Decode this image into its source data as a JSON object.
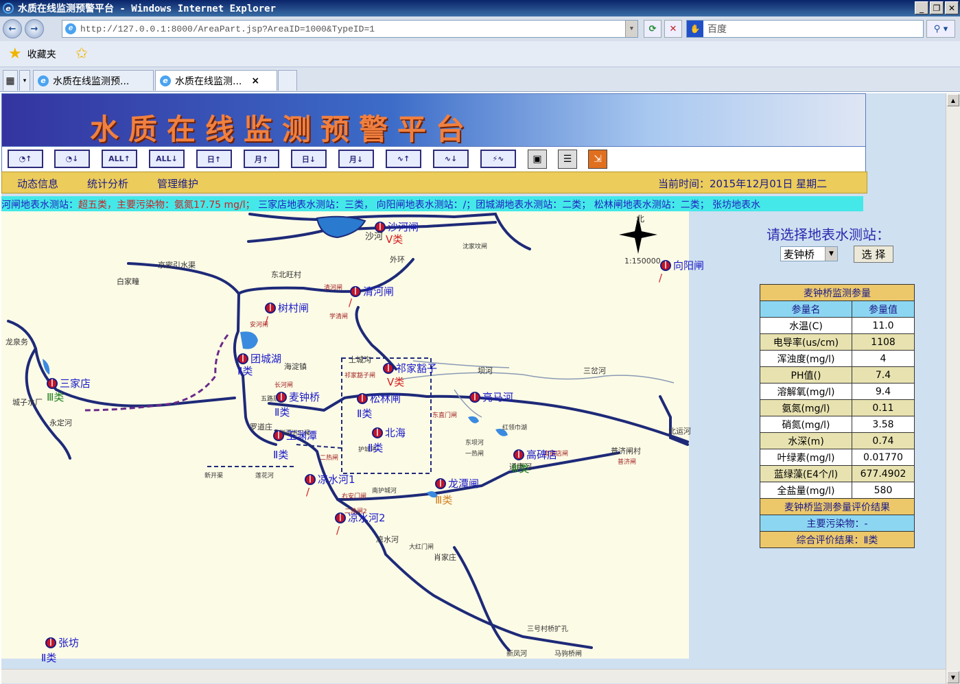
{
  "window": {
    "title": "水质在线监测预警平台 - Windows Internet Explorer"
  },
  "browser": {
    "url": "http://127.0.0.1:8000/AreaPart.jsp?AreaID=1000&TypeID=1",
    "search_placeholder": "百度",
    "favorites_label": "收藏夹",
    "tabs": [
      {
        "label": "水质在线监测预..."
      },
      {
        "label": "水质在线监测...",
        "close": "×"
      }
    ]
  },
  "page": {
    "banner_title": "水质在线监测预警平台",
    "toolbar_buttons": [
      "rt-up",
      "rt-down",
      "all-up",
      "all-down",
      "day-up",
      "month-up",
      "day-down",
      "month-down",
      "trend-up",
      "trend-down",
      "alarm",
      "monitor",
      "report",
      "export"
    ],
    "menu": [
      "动态信息",
      "统计分析",
      "管理维护"
    ],
    "current_time": "当前时间：2015年12月01日 星期二",
    "ticker": {
      "part1": "河闸地表水测站：",
      "part2": "超五类，主要污染物：氨氮17.75 mg/l；",
      "part3": "  三家店地表水测站：三类，  向阳闸地表水测站：/；团城湖地表水测站：二类；  松林闸地表水测站：二类；  张坊地表水"
    }
  },
  "map": {
    "stations": [
      {
        "name": "沙河闸",
        "class": "Ⅴ类",
        "class_color": "#d02020"
      },
      {
        "name": "向阳闸",
        "class": "/",
        "class_color": "#d02020"
      },
      {
        "name": "清河闸",
        "class": "/",
        "class_color": "#d02020"
      },
      {
        "name": "树村闸",
        "class": "/",
        "class_color": "#d02020"
      },
      {
        "name": "团城湖",
        "class": "Ⅱ类",
        "class_color": "#1a1ac8"
      },
      {
        "name": "祁家豁子",
        "class": "Ⅴ类",
        "class_color": "#d02020"
      },
      {
        "name": "三家店",
        "class": "Ⅲ类",
        "class_color": "#208020"
      },
      {
        "name": "麦钟桥",
        "class": "Ⅱ类",
        "class_color": "#1a1ac8"
      },
      {
        "name": "松林闸",
        "class": "Ⅱ类",
        "class_color": "#1a1ac8"
      },
      {
        "name": "亮马河",
        "class": "",
        "class_color": "#1a1ac8"
      },
      {
        "name": "北海",
        "class": "Ⅱ类",
        "class_color": "#1a1ac8"
      },
      {
        "name": "玉渊潭",
        "class": "Ⅱ类",
        "class_color": "#1a1ac8"
      },
      {
        "name": "高碑店",
        "class": "Ⅲ类",
        "class_color": "#208020"
      },
      {
        "name": "凉水河1",
        "class": "/",
        "class_color": "#d02020"
      },
      {
        "name": "龙潭闸",
        "class": "Ⅲ类",
        "class_color": "#d08020"
      },
      {
        "name": "凉水河2",
        "class": "/",
        "class_color": "#d02020"
      },
      {
        "name": "张坊",
        "class": "Ⅱ类",
        "class_color": "#1a1ac8"
      }
    ],
    "labels": {
      "north": "北",
      "scale": "1:150000",
      "place_1": "沙河",
      "place_2": "东北旺村",
      "place_3": "白家疃",
      "place_4": "海淀镇",
      "place_5": "三岔河",
      "place_6": "肖家庄",
      "place_7": "罗道庄",
      "place_8": "普济闸村",
      "place_9": "龙泉务",
      "place_10": "城子水厂",
      "place_11": "三号村桥扩孔",
      "place_12": "马驹桥闸",
      "place_13": "沈家坟闸",
      "place_14": "大红门闸",
      "place_15": "北运河",
      "river_1": "京密引水渠",
      "river_2": "永定河",
      "river_3": "凉水河",
      "river_4": "通惠河",
      "river_5": "外环",
      "river_6": "土城沟",
      "river_7": "坝河",
      "river_8": "新凤河",
      "pump_1": "安河闸",
      "pump_2": "清河闸",
      "pump_3": "学清闸",
      "pump_4": "祁家豁子闸",
      "pump_5": "东直门闸",
      "pump_6": "二热闸",
      "pump_7": "高碑店闸",
      "pump_8": "普济闸",
      "pump_9": "长河闸",
      "pump_10": "右安门闸",
      "pump_11": "红领巾湖",
      "pump_12": "东坝河",
      "pump_13": "一热闸",
      "pump_14": "南护城河",
      "pump_15": "护城河",
      "pump_16": "二热闸2",
      "pump_17": "新开渠",
      "pump_18": "莲花河",
      "pump_19": "玉渊潭进口闸",
      "pump_20": "五路居"
    }
  },
  "panel": {
    "prompt": "请选择地表水测站：",
    "selected_station": "麦钟桥",
    "select_button": "选 择",
    "table_title": "麦钟桥监测参量",
    "col_name": "参量名",
    "col_value": "参量值",
    "params": [
      {
        "name": "水温(C)",
        "value": "11.0"
      },
      {
        "name": "电导率(us/cm)",
        "value": "1108"
      },
      {
        "name": "浑浊度(mg/l)",
        "value": "4"
      },
      {
        "name": "PH值()",
        "value": "7.4"
      },
      {
        "name": "溶解氧(mg/l)",
        "value": "9.4"
      },
      {
        "name": "氨氮(mg/l)",
        "value": "0.11"
      },
      {
        "name": "硝氮(mg/l)",
        "value": "3.58"
      },
      {
        "name": "水深(m)",
        "value": "0.74"
      },
      {
        "name": "叶绿素(mg/l)",
        "value": "0.01770"
      },
      {
        "name": "蓝绿藻(E4个/l)",
        "value": "677.4902"
      },
      {
        "name": "全盐量(mg/l)",
        "value": "580"
      }
    ],
    "eval_title": "麦钟桥监测参量评价结果",
    "main_pollutant": "主要污染物：-",
    "overall_result": "综合评价结果：Ⅱ类"
  }
}
